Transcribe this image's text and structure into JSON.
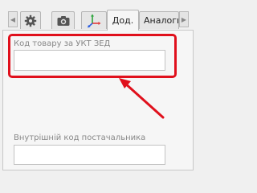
{
  "tabs": {
    "settings_icon": "gear-icon",
    "camera_icon": "camera-icon",
    "axes_icon": "axes-icon",
    "active_label": "Дод.",
    "next_label": "Аналоги"
  },
  "fields": {
    "uktzed_label": "Код товару за УКТ ЗЕД",
    "uktzed_value": "",
    "supplier_code_label": "Внутрішній код постачальника",
    "supplier_code_value": ""
  },
  "annotation": {
    "highlight_color": "#e0101c"
  }
}
